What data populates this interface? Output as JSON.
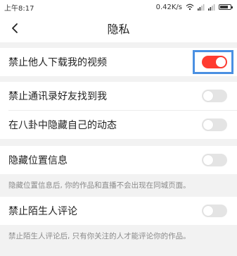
{
  "status_bar": {
    "time": "上午8:17",
    "network_speed": "0.42K/s",
    "icons": [
      "wifi-icon",
      "signal-icon",
      "signal-icon",
      "battery-icon"
    ]
  },
  "header": {
    "back_icon": "chevron-left-icon",
    "title": "隐私"
  },
  "settings": {
    "disable_download": {
      "label": "禁止他人下载我的视频",
      "enabled": true
    },
    "disable_contacts": {
      "label": "禁止通讯录好友找到我",
      "enabled": false
    },
    "hide_gossip": {
      "label": "在八卦中隐藏自己的动态",
      "enabled": false
    },
    "hide_location": {
      "label": "隐藏位置信息",
      "enabled": false,
      "note": "隐藏位置信息后, 你的作品和直播不会出现在同城页面。"
    },
    "disable_stranger_comments": {
      "label": "禁止陌生人评论",
      "enabled": false,
      "note": "禁止陌生人评论后, 只有你关注的人才能评论你的作品。"
    }
  },
  "colors": {
    "toggle_on": "#ff3b30",
    "toggle_off": "#e4e4e4",
    "highlight": "#4a90e2"
  }
}
